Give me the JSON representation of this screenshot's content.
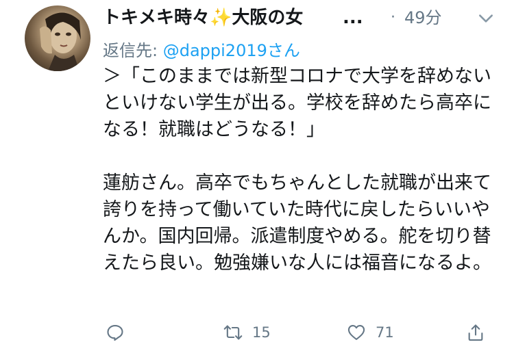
{
  "tweet": {
    "display_name": "トキメキ時々",
    "display_name_emoji": "✨",
    "display_name_rest": "大阪の女",
    "name_truncation": "...",
    "separator": "·",
    "timestamp": "49分",
    "reply_prefix": "返信先: ",
    "reply_handle": "@dappi2019",
    "reply_suffix": "さん",
    "body_paragraphs": [
      "＞「このままでは新型コロナで大学を辞めないといけない学生が出る。学校を辞めたら高卒になる！就職はどうなる！」",
      "蓮舫さん。高卒でもちゃんとした就職が出来て誇りを持って働いていた時代に戻したらいいやんか。国内回帰。派遣制度やめる。舵を切り替えたら良い。勉強嫌いな人には福音になるよ。"
    ],
    "retweet_count": "15",
    "like_count": "71"
  },
  "icons": {
    "more": "chevron-down-icon",
    "reply": "reply-icon",
    "retweet": "retweet-icon",
    "like": "heart-icon",
    "share": "share-icon"
  },
  "colors": {
    "text": "#14171a",
    "secondary": "#657786",
    "link": "#1da1f2",
    "sparkle": "#f5c518"
  }
}
